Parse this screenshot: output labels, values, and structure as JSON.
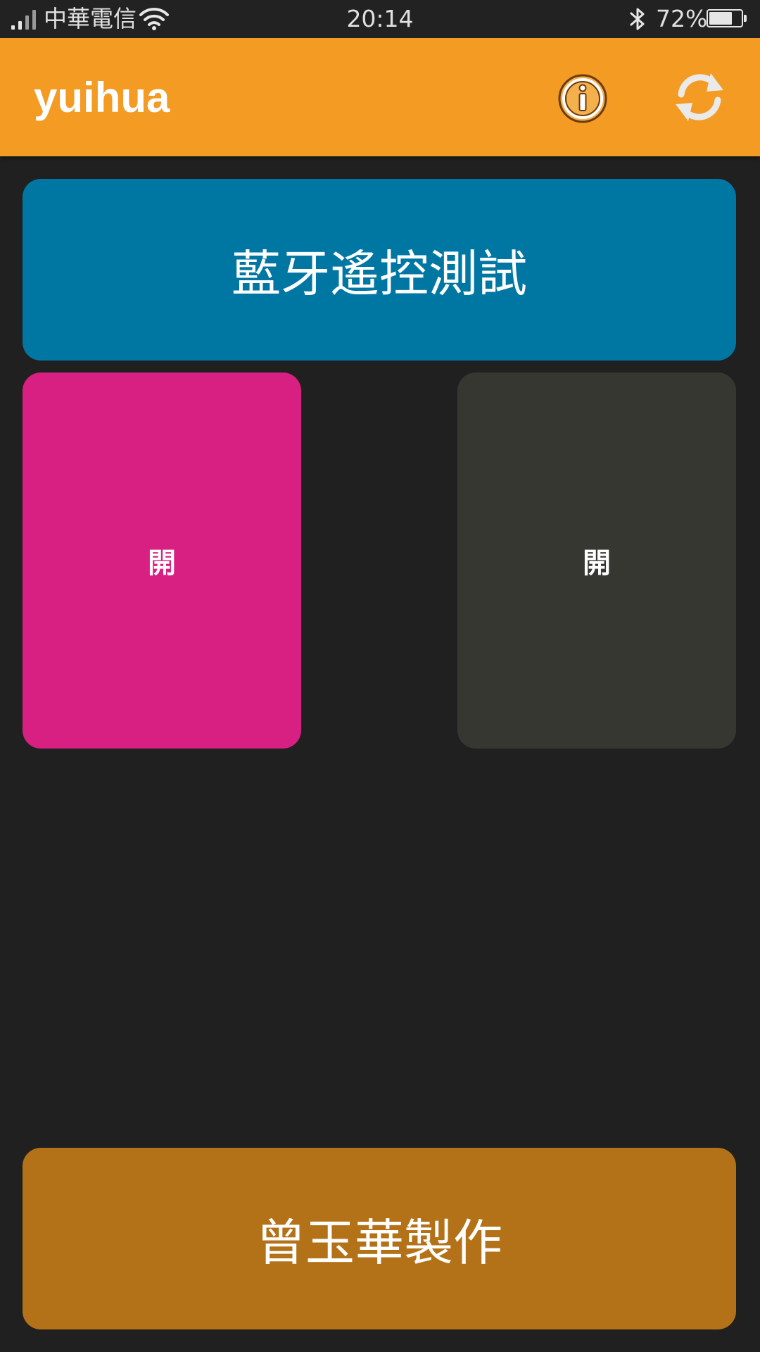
{
  "status_bar": {
    "carrier": "中華電信",
    "time": "20:14",
    "battery_percent": "72%",
    "battery_level": 0.72,
    "signal_bars_active": 2,
    "icons": [
      "signal-icon",
      "wifi-icon",
      "bluetooth-icon",
      "battery-icon"
    ]
  },
  "app_bar": {
    "title": "yuihua",
    "background": "#f39b22",
    "actions": [
      {
        "icon": "info-icon"
      },
      {
        "icon": "refresh-icon"
      }
    ]
  },
  "main": {
    "bluetooth_button": {
      "label": "藍牙遙控測試",
      "color": "#0077a3"
    },
    "left_switch": {
      "label": "開",
      "color": "#d72082"
    },
    "right_switch": {
      "label": "開",
      "color": "#373732"
    },
    "credit_button": {
      "label": "曾玉華製作",
      "color": "#b47218"
    }
  }
}
